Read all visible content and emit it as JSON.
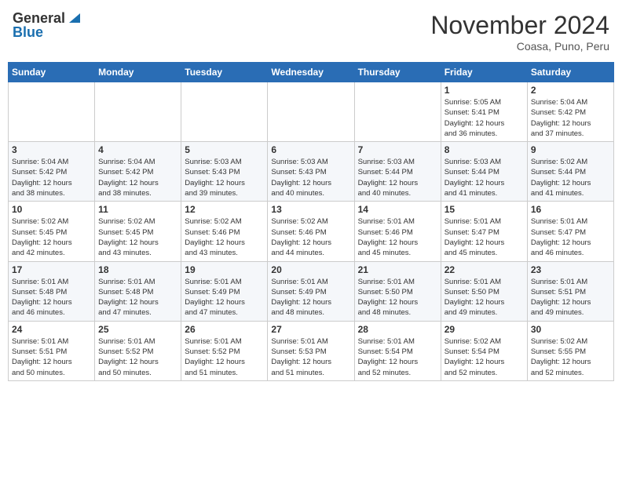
{
  "header": {
    "logo_general": "General",
    "logo_blue": "Blue",
    "month": "November 2024",
    "location": "Coasa, Puno, Peru"
  },
  "weekdays": [
    "Sunday",
    "Monday",
    "Tuesday",
    "Wednesday",
    "Thursday",
    "Friday",
    "Saturday"
  ],
  "weeks": [
    [
      {
        "day": "",
        "info": ""
      },
      {
        "day": "",
        "info": ""
      },
      {
        "day": "",
        "info": ""
      },
      {
        "day": "",
        "info": ""
      },
      {
        "day": "",
        "info": ""
      },
      {
        "day": "1",
        "info": "Sunrise: 5:05 AM\nSunset: 5:41 PM\nDaylight: 12 hours\nand 36 minutes."
      },
      {
        "day": "2",
        "info": "Sunrise: 5:04 AM\nSunset: 5:42 PM\nDaylight: 12 hours\nand 37 minutes."
      }
    ],
    [
      {
        "day": "3",
        "info": "Sunrise: 5:04 AM\nSunset: 5:42 PM\nDaylight: 12 hours\nand 38 minutes."
      },
      {
        "day": "4",
        "info": "Sunrise: 5:04 AM\nSunset: 5:42 PM\nDaylight: 12 hours\nand 38 minutes."
      },
      {
        "day": "5",
        "info": "Sunrise: 5:03 AM\nSunset: 5:43 PM\nDaylight: 12 hours\nand 39 minutes."
      },
      {
        "day": "6",
        "info": "Sunrise: 5:03 AM\nSunset: 5:43 PM\nDaylight: 12 hours\nand 40 minutes."
      },
      {
        "day": "7",
        "info": "Sunrise: 5:03 AM\nSunset: 5:44 PM\nDaylight: 12 hours\nand 40 minutes."
      },
      {
        "day": "8",
        "info": "Sunrise: 5:03 AM\nSunset: 5:44 PM\nDaylight: 12 hours\nand 41 minutes."
      },
      {
        "day": "9",
        "info": "Sunrise: 5:02 AM\nSunset: 5:44 PM\nDaylight: 12 hours\nand 41 minutes."
      }
    ],
    [
      {
        "day": "10",
        "info": "Sunrise: 5:02 AM\nSunset: 5:45 PM\nDaylight: 12 hours\nand 42 minutes."
      },
      {
        "day": "11",
        "info": "Sunrise: 5:02 AM\nSunset: 5:45 PM\nDaylight: 12 hours\nand 43 minutes."
      },
      {
        "day": "12",
        "info": "Sunrise: 5:02 AM\nSunset: 5:46 PM\nDaylight: 12 hours\nand 43 minutes."
      },
      {
        "day": "13",
        "info": "Sunrise: 5:02 AM\nSunset: 5:46 PM\nDaylight: 12 hours\nand 44 minutes."
      },
      {
        "day": "14",
        "info": "Sunrise: 5:01 AM\nSunset: 5:46 PM\nDaylight: 12 hours\nand 45 minutes."
      },
      {
        "day": "15",
        "info": "Sunrise: 5:01 AM\nSunset: 5:47 PM\nDaylight: 12 hours\nand 45 minutes."
      },
      {
        "day": "16",
        "info": "Sunrise: 5:01 AM\nSunset: 5:47 PM\nDaylight: 12 hours\nand 46 minutes."
      }
    ],
    [
      {
        "day": "17",
        "info": "Sunrise: 5:01 AM\nSunset: 5:48 PM\nDaylight: 12 hours\nand 46 minutes."
      },
      {
        "day": "18",
        "info": "Sunrise: 5:01 AM\nSunset: 5:48 PM\nDaylight: 12 hours\nand 47 minutes."
      },
      {
        "day": "19",
        "info": "Sunrise: 5:01 AM\nSunset: 5:49 PM\nDaylight: 12 hours\nand 47 minutes."
      },
      {
        "day": "20",
        "info": "Sunrise: 5:01 AM\nSunset: 5:49 PM\nDaylight: 12 hours\nand 48 minutes."
      },
      {
        "day": "21",
        "info": "Sunrise: 5:01 AM\nSunset: 5:50 PM\nDaylight: 12 hours\nand 48 minutes."
      },
      {
        "day": "22",
        "info": "Sunrise: 5:01 AM\nSunset: 5:50 PM\nDaylight: 12 hours\nand 49 minutes."
      },
      {
        "day": "23",
        "info": "Sunrise: 5:01 AM\nSunset: 5:51 PM\nDaylight: 12 hours\nand 49 minutes."
      }
    ],
    [
      {
        "day": "24",
        "info": "Sunrise: 5:01 AM\nSunset: 5:51 PM\nDaylight: 12 hours\nand 50 minutes."
      },
      {
        "day": "25",
        "info": "Sunrise: 5:01 AM\nSunset: 5:52 PM\nDaylight: 12 hours\nand 50 minutes."
      },
      {
        "day": "26",
        "info": "Sunrise: 5:01 AM\nSunset: 5:52 PM\nDaylight: 12 hours\nand 51 minutes."
      },
      {
        "day": "27",
        "info": "Sunrise: 5:01 AM\nSunset: 5:53 PM\nDaylight: 12 hours\nand 51 minutes."
      },
      {
        "day": "28",
        "info": "Sunrise: 5:01 AM\nSunset: 5:54 PM\nDaylight: 12 hours\nand 52 minutes."
      },
      {
        "day": "29",
        "info": "Sunrise: 5:02 AM\nSunset: 5:54 PM\nDaylight: 12 hours\nand 52 minutes."
      },
      {
        "day": "30",
        "info": "Sunrise: 5:02 AM\nSunset: 5:55 PM\nDaylight: 12 hours\nand 52 minutes."
      }
    ]
  ]
}
